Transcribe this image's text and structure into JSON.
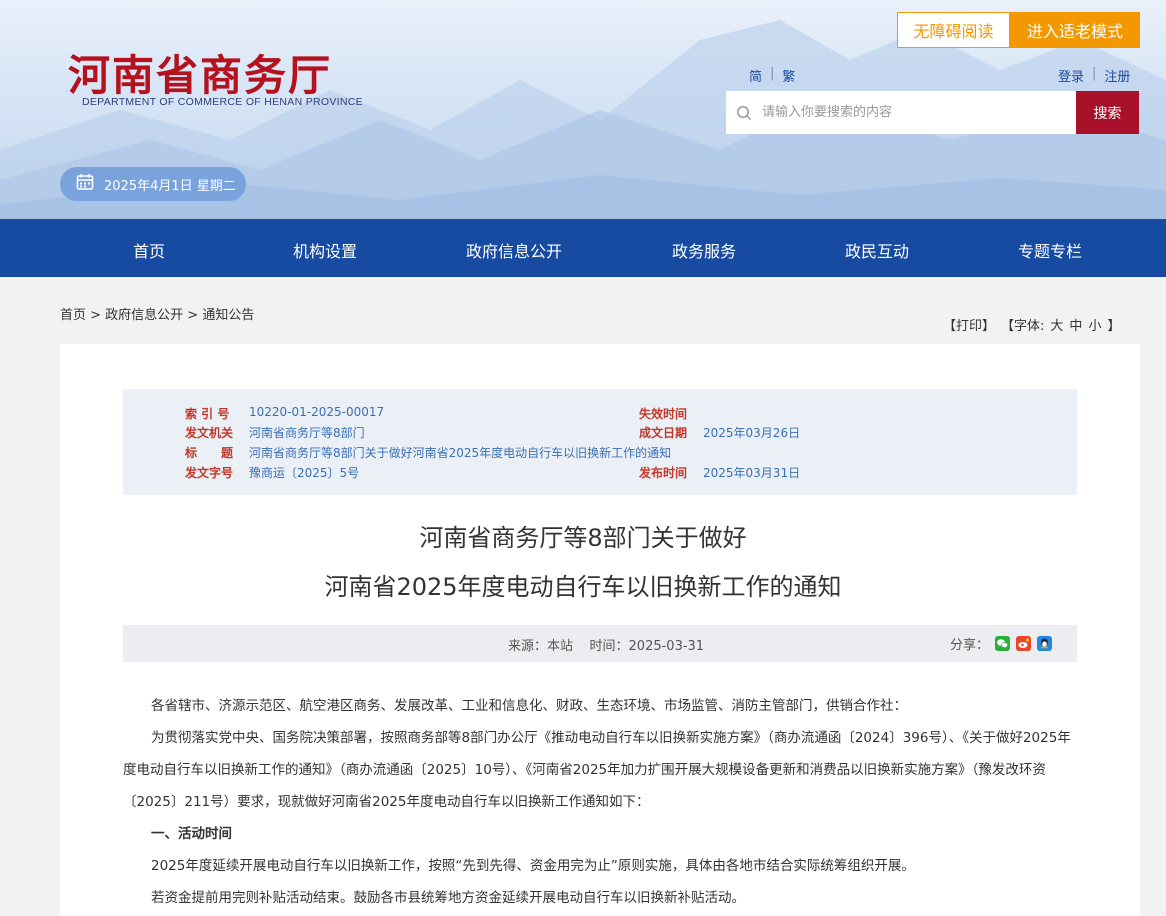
{
  "header": {
    "logo_title": "河南省商务厅",
    "logo_subtitle": "DEPARTMENT OF COMMERCE OF HENAN PROVINCE",
    "accessibility_label": "无障碍阅读",
    "elder_mode_label": "进入适老模式",
    "lang_simplified": "简",
    "lang_traditional": "繁",
    "login_label": "登录",
    "register_label": "注册",
    "search_placeholder": "请输入你要搜索的内容",
    "search_button": "搜索",
    "date": "2025年4月1日 星期二",
    "separator": "|"
  },
  "nav": {
    "items": [
      "首页",
      "机构设置",
      "政府信息公开",
      "政务服务",
      "政民互动",
      "专题专栏"
    ]
  },
  "breadcrumb": "首页 > 政府信息公开 > 通知公告",
  "tools": {
    "print": "【打印】",
    "font": "【字体:",
    "large": "大",
    "medium": "中",
    "small": "小",
    "close": "】"
  },
  "meta": {
    "index_label": "索 引 号",
    "index_value": "10220-01-2025-00017",
    "expire_label": "失效时间",
    "expire_value": "",
    "issuer_label": "发文机关",
    "issuer_value": "河南省商务厅等8部门",
    "created_label": "成文日期",
    "created_value": "2025年03月26日",
    "title_label": "标　　题",
    "title_value": "河南省商务厅等8部门关于做好河南省2025年度电动自行车以旧换新工作的通知",
    "docno_label": "发文字号",
    "docno_value": "豫商运〔2025〕5号",
    "publish_label": "发布时间",
    "publish_value": "2025年03月31日"
  },
  "article": {
    "title_line1": "河南省商务厅等8部门关于做好",
    "title_line2": "河南省2025年度电动自行车以旧换新工作的通知",
    "source": "来源：本站    时间：2025-03-31",
    "share_label": "分享：",
    "p1": "各省辖市、济源示范区、航空港区商务、发展改革、工业和信息化、财政、生态环境、市场监管、消防主管部门，供销合作社：",
    "p2": "为贯彻落实党中央、国务院决策部署，按照商务部等8部门办公厅《推动电动自行车以旧换新实施方案》（商办流通函〔2024〕396号）、《关于做好2025年度电动自行车以旧换新工作的通知》（商办流通函〔2025〕10号）、《河南省2025年加力扩围开展大规模设备更新和消费品以旧换新实施方案》（豫发改环资〔2025〕211号）要求，现就做好河南省2025年度电动自行车以旧换新工作通知如下：",
    "h1": "一、活动时间",
    "p3": "2025年度延续开展电动自行车以旧换新工作，按照“先到先得、资金用完为止”原则实施，具体由各地市结合实际统筹组织开展。",
    "p4": "若资金提前用完则补贴活动结束。鼓励各市县统筹地方资金延续开展电动自行车以旧换新补贴活动。"
  },
  "colors": {
    "brand_red": "#b3121e",
    "nav_blue": "#174ba2",
    "orange": "#f39800"
  }
}
